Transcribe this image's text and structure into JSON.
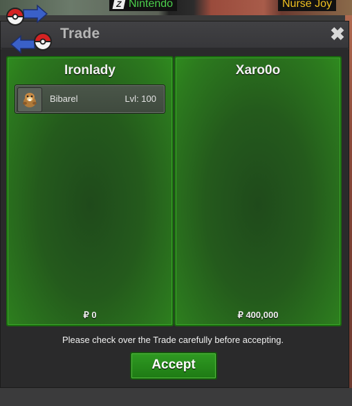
{
  "background": {
    "tag_left": "Nintendo",
    "tag_right": "Nurse Joy"
  },
  "dialog": {
    "title": "Trade",
    "close_label": "✖",
    "notice": "Please check over the Trade carefully before accepting.",
    "accept_label": "Accept"
  },
  "left_panel": {
    "player": "Ironlady",
    "money": "₽ 0",
    "items": [
      {
        "name": "Bibarel",
        "level": "Lvl: 100",
        "icon": "bibarel-pokemon-icon"
      }
    ]
  },
  "right_panel": {
    "player": "Xaro0o",
    "money": "₽ 400,000",
    "items": []
  },
  "colors": {
    "panel_green": "#2c7a1e",
    "accept_green": "#2f9a22",
    "dialog_bg": "#2f2f31"
  }
}
